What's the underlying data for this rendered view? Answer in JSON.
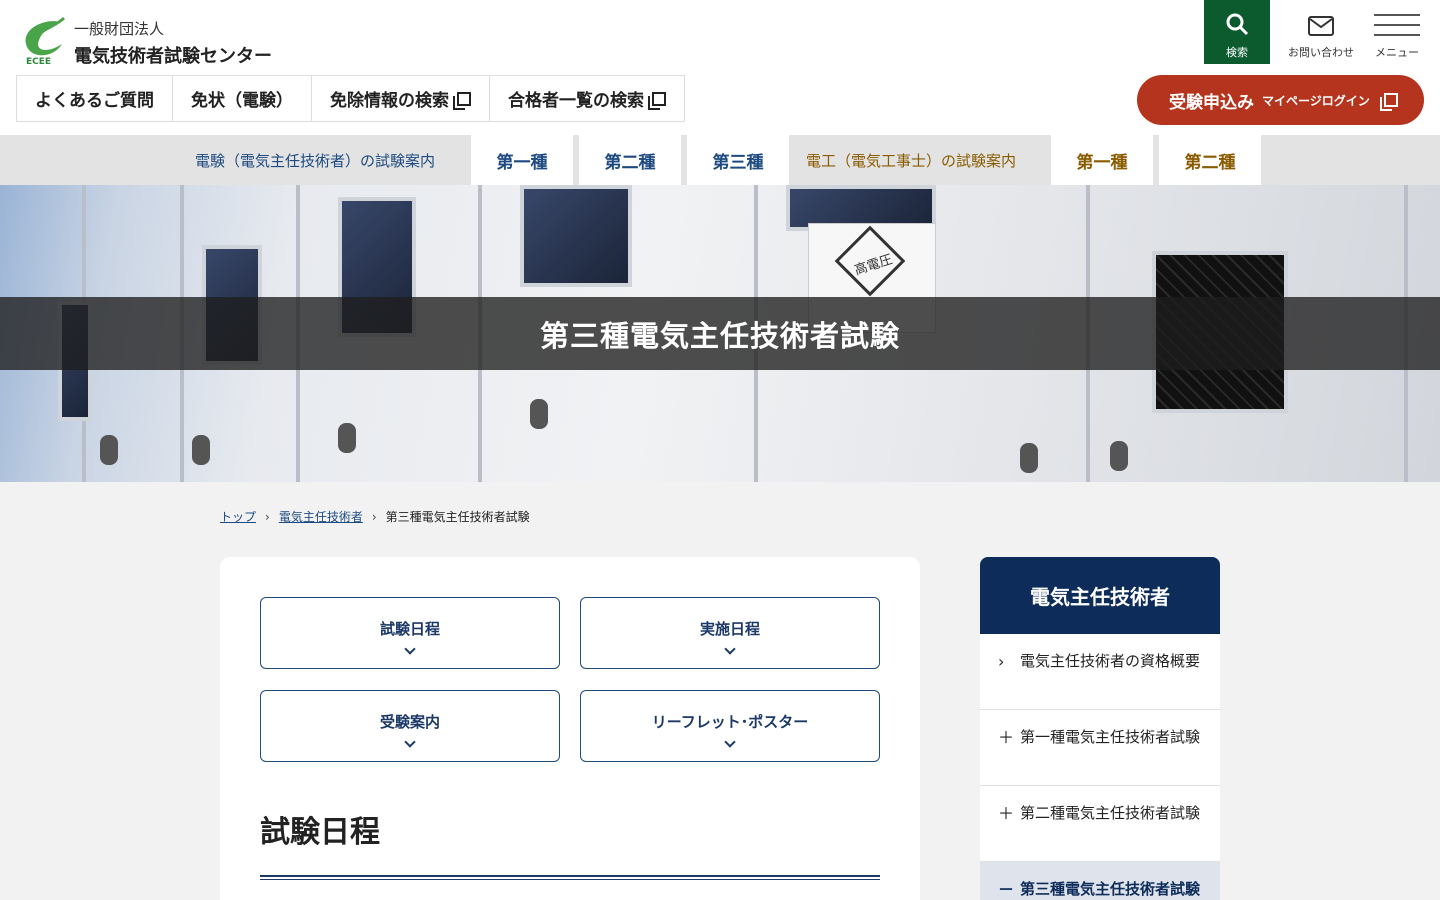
{
  "header": {
    "logo_text": "ECEE",
    "org_sub": "一般財団法人",
    "org_name": "電気技術者試験センター",
    "search_label": "検索",
    "contact_label": "お問い合わせ",
    "menu_label": "メニュー",
    "quick_nav": [
      {
        "label": "よくあるご質問"
      },
      {
        "label": "免状（電験）"
      },
      {
        "label": "免除情報の検索"
      },
      {
        "label": "合格者一覧の検索"
      }
    ],
    "apply": {
      "main": "受験申込み",
      "sub": "マイページログイン"
    }
  },
  "exam_nav": {
    "denken_guide": "電験（電気主任技術者）の試験案内",
    "denken_tabs": [
      "第一種",
      "第二種",
      "第三種"
    ],
    "denko_guide": "電工（電気工事士）の試験案内",
    "denko_tabs": [
      "第一種",
      "第二種"
    ]
  },
  "hero": {
    "title": "第三種電気主任技術者試験",
    "hazard_text": "高電圧"
  },
  "breadcrumb": [
    "トップ",
    "電気主任技術者",
    "第三種電気主任技術者試験"
  ],
  "main": {
    "anchors": [
      "試験日程",
      "実施日程",
      "受験案内",
      "リーフレット･ポスター"
    ],
    "section_title": "試験日程"
  },
  "sidebar": {
    "heading": "電気主任技術者",
    "items": [
      {
        "mark": "›",
        "label": "電気主任技術者の資格概要"
      },
      {
        "mark": "＋",
        "label": "第一種電気主任技術者試験"
      },
      {
        "mark": "＋",
        "label": "第二種電気主任技術者試験"
      },
      {
        "mark": "－",
        "label": "第三種電気主任技術者試験"
      }
    ]
  },
  "colors": {
    "brand_green": "#0b5b2f",
    "navy": "#0d2c5a",
    "apply_red": "#b5341d",
    "denken_blue": "#1d4a80",
    "denko_brown": "#8a5b00"
  }
}
